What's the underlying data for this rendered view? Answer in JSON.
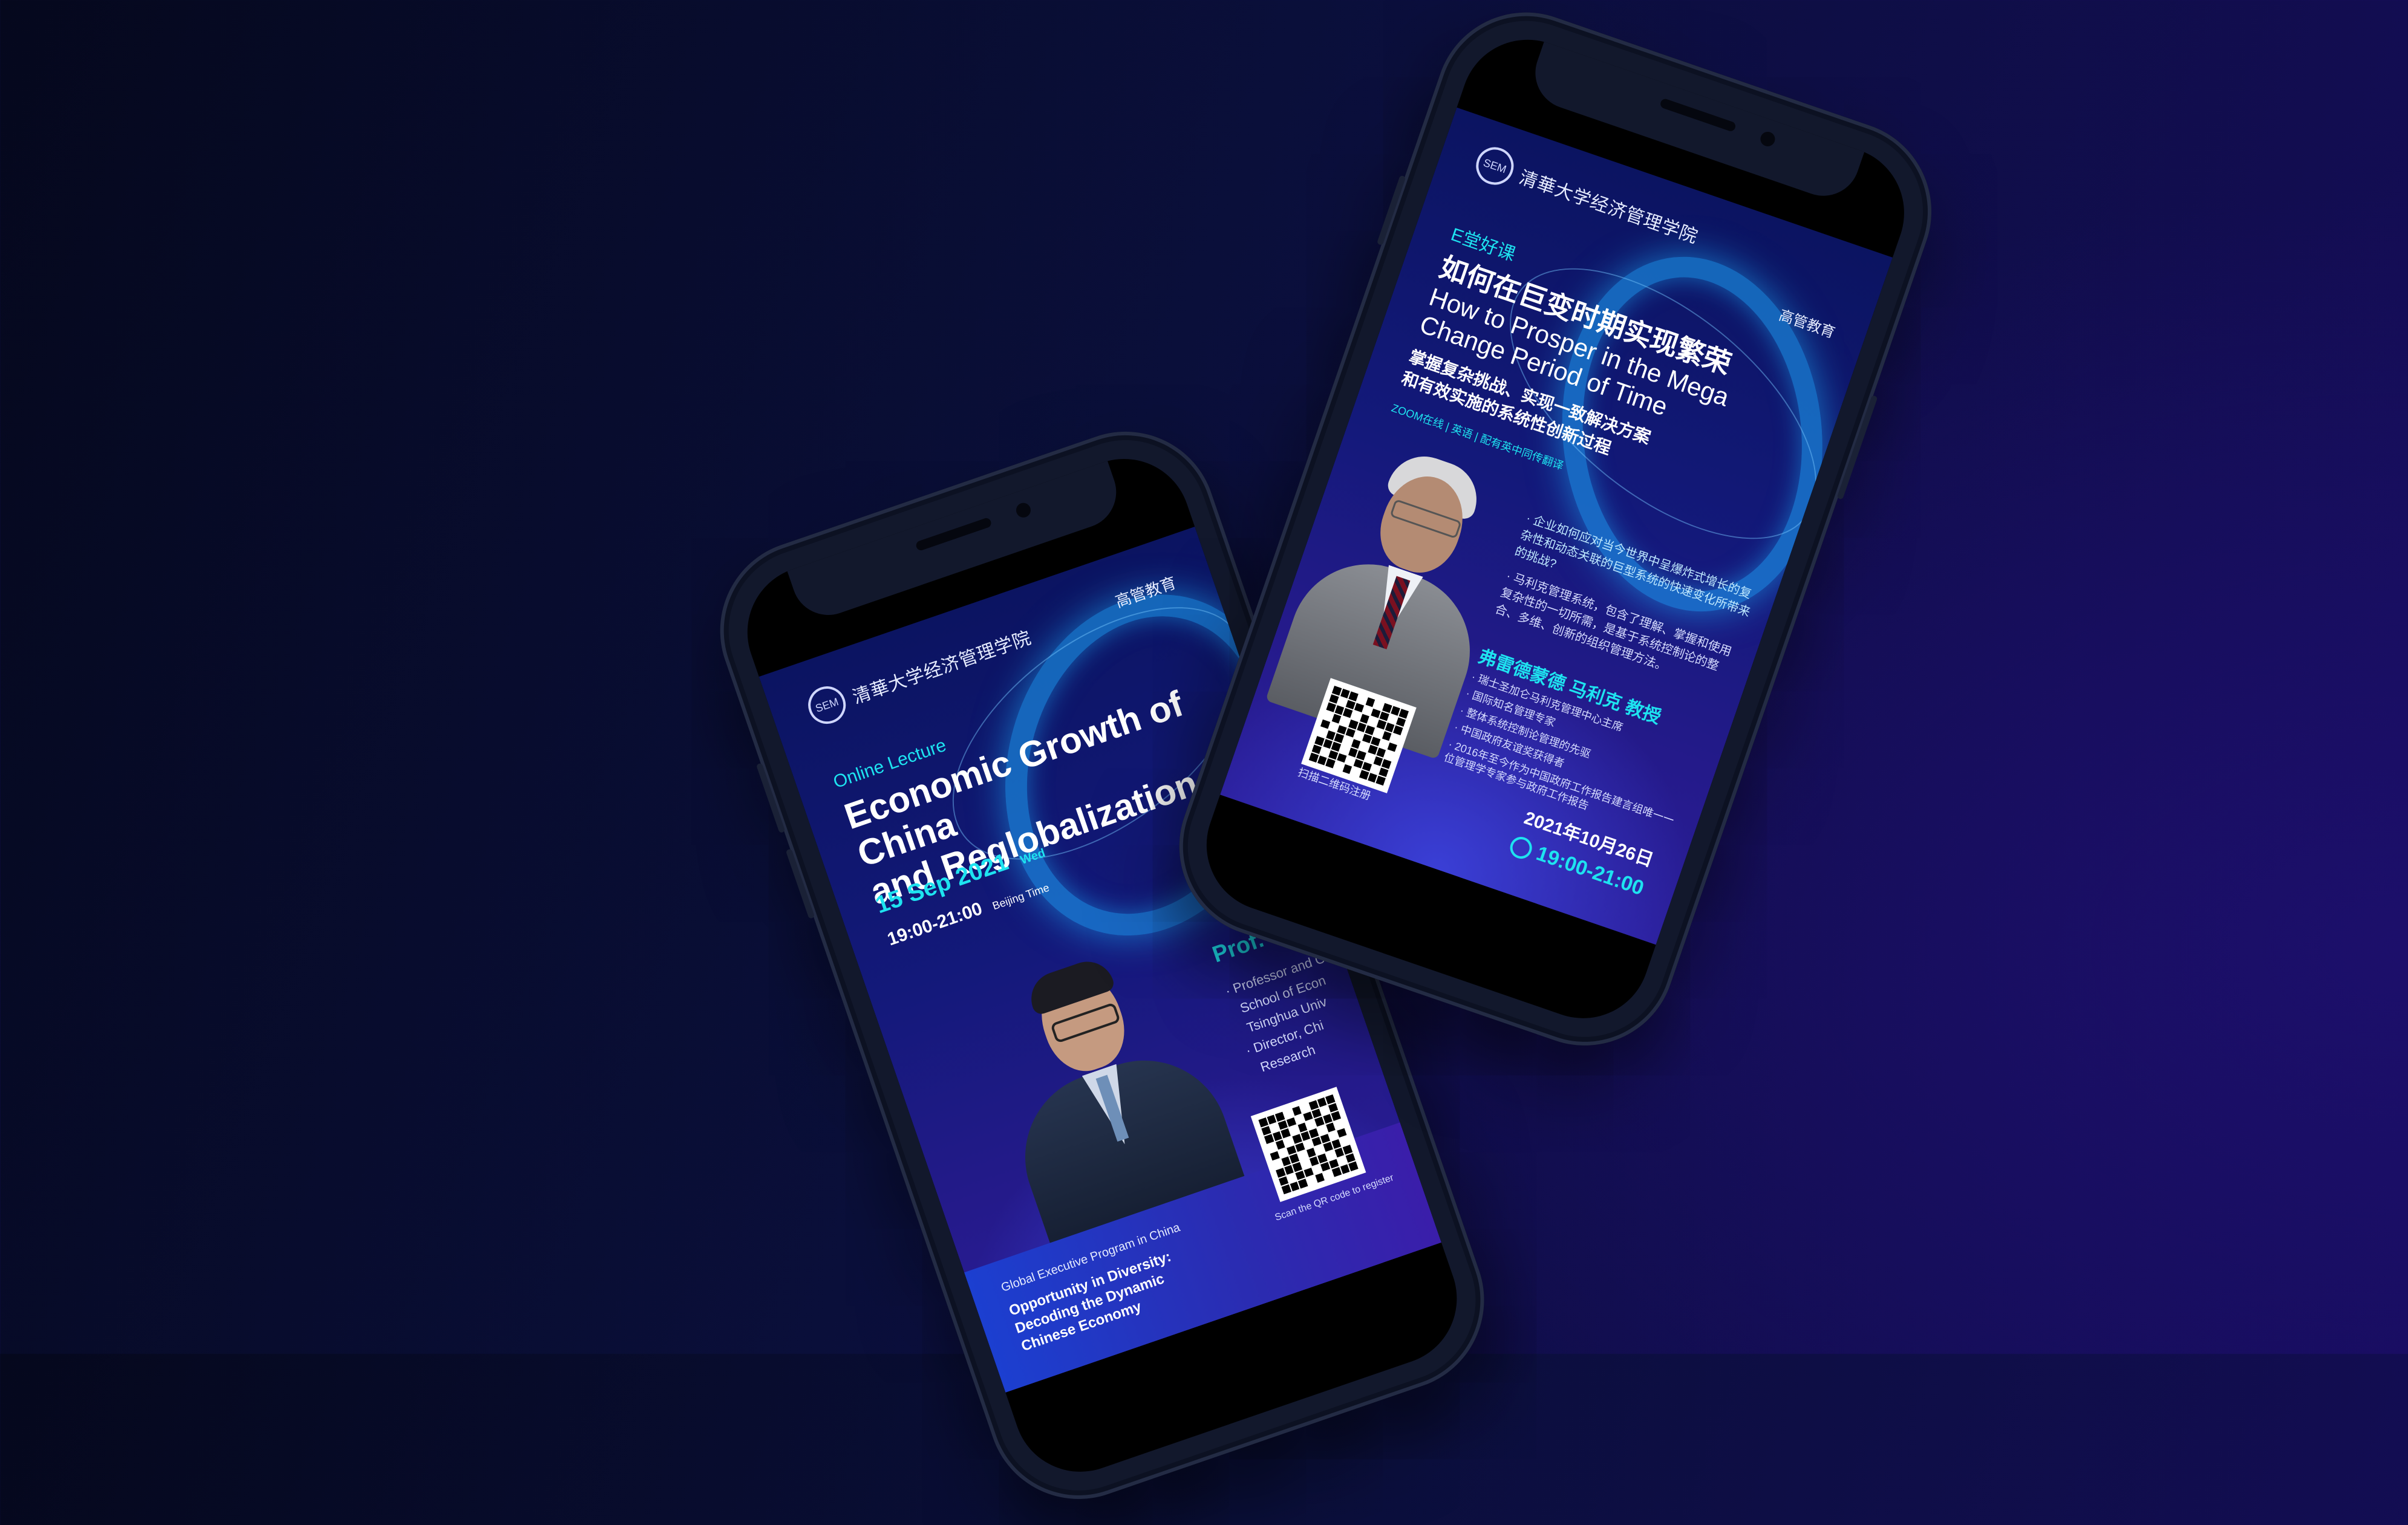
{
  "colors": {
    "accent": "#1ee3f0",
    "poster_top": "#0b1461",
    "poster_bottom": "#2b1e9a",
    "phone_frame": "#12182c"
  },
  "left_poster": {
    "logo_main": "清華大学经济管理学院",
    "logo_secondary": "高管教育",
    "label": "Online Lecture",
    "title_line1": "Economic Growth of China",
    "title_line2": "and Reglobalization",
    "date": "15 Sep 2021",
    "weekday": "Wed",
    "time": "19:00-21:00",
    "time_zone": "Beijing Time",
    "speaker_name": "Prof. HE Pin",
    "bio": [
      "· Professor and Ch",
      "School of Econ",
      "Tsinghua Univ",
      "· Director, Chi",
      "Research"
    ],
    "program_label": "Global Executive Program in China",
    "program_line1": "Opportunity in Diversity:",
    "program_line2": "Decoding the Dynamic",
    "program_line3": "Chinese Economy",
    "qr_caption": "Scan the QR code to register"
  },
  "right_poster": {
    "logo_main": "清華大学经济管理学院",
    "logo_secondary": "高管教育",
    "tag": "E堂好课",
    "title_cn": "如何在巨变时期实现繁荣",
    "title_en_line1": "How to Prosper in the Mega",
    "title_en_line2": "Change Period of Time",
    "subtitle_line1": "掌握复杂挑战、实现一致解决方案",
    "subtitle_line2": "和有效实施的系统性创新过程",
    "meta": "ZOOM在线 | 英语 | 配有英中同传翻译",
    "question": "· 企业如何应对当今世界中呈爆炸式增长的复杂性和动态关联的巨型系统的快速变化所带来的挑战?",
    "intro": "· 马利克管理系统，包含了理解、掌握和使用复杂性的一切所需，是基于系统控制论的整合、多维、创新的组织管理方法。",
    "speaker_name": "弗雷德蒙德 马利克 教授",
    "bio": [
      "· 瑞士圣加仑马利克管理中心主席",
      "· 国际知名管理专家",
      "· 整体系统控制论管理的先驱",
      "· 中国政府友谊奖获得者",
      "· 2016年至今作为中国政府工作报告建言组唯一一位管理学专家参与政府工作报告"
    ],
    "qr_caption": "扫描二维码注册",
    "date": "2021年10月26日",
    "time": "19:00-21:00"
  }
}
